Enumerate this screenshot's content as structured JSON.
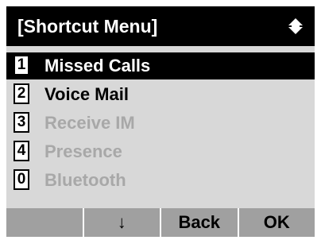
{
  "title": "[Shortcut Menu]",
  "title_icon": "up-down-arrow-icon",
  "menu": {
    "items": [
      {
        "key": "1",
        "label": "Missed Calls",
        "state": "selected"
      },
      {
        "key": "2",
        "label": "Voice Mail",
        "state": "enabled"
      },
      {
        "key": "3",
        "label": "Receive IM",
        "state": "disabled"
      },
      {
        "key": "4",
        "label": "Presence",
        "state": "disabled"
      },
      {
        "key": "0",
        "label": "Bluetooth",
        "state": "disabled"
      }
    ]
  },
  "softkeys": [
    "",
    "↓",
    "Back",
    "OK"
  ],
  "colors": {
    "title_bg": "#000000",
    "screen_bg": "#d8d8d8",
    "softkey_bg": "#a0a0a0",
    "disabled_text": "#a8a8a8"
  }
}
